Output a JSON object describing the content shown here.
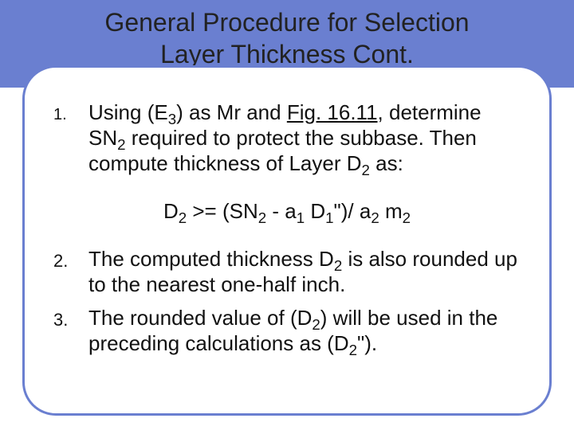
{
  "title_line1": "General Procedure for Selection",
  "title_line2": "Layer Thickness Cont.",
  "items": [
    {
      "num": "1.",
      "pre": "Using (E",
      "sub1": "3",
      "mid1": ") as Mr and ",
      "figref": "Fig. 16.11",
      "mid2": ", determine SN",
      "sub2": "2",
      "mid3": " required to protect the subbase. Then compute thickness of Layer D",
      "sub3": "2",
      "tail": " as:"
    },
    {
      "num": "2.",
      "pre": "The computed thickness D",
      "sub1": "2",
      "tail": " is also rounded up to the nearest one-half inch."
    },
    {
      "num": "3.",
      "pre": "The rounded value of (D",
      "sub1": "2",
      "mid1": ") will be used in the preceding calculations as (D",
      "sub2": "2",
      "tail": "\")."
    }
  ],
  "formula": {
    "p1": "D",
    "s1": "2",
    "p2": " >= (SN",
    "s2": "2",
    "p3": " - a",
    "s3": "1",
    "p4": " D",
    "s4": "1",
    "p5": "\")/ a",
    "s5": "2",
    "p6": " m",
    "s6": "2"
  }
}
